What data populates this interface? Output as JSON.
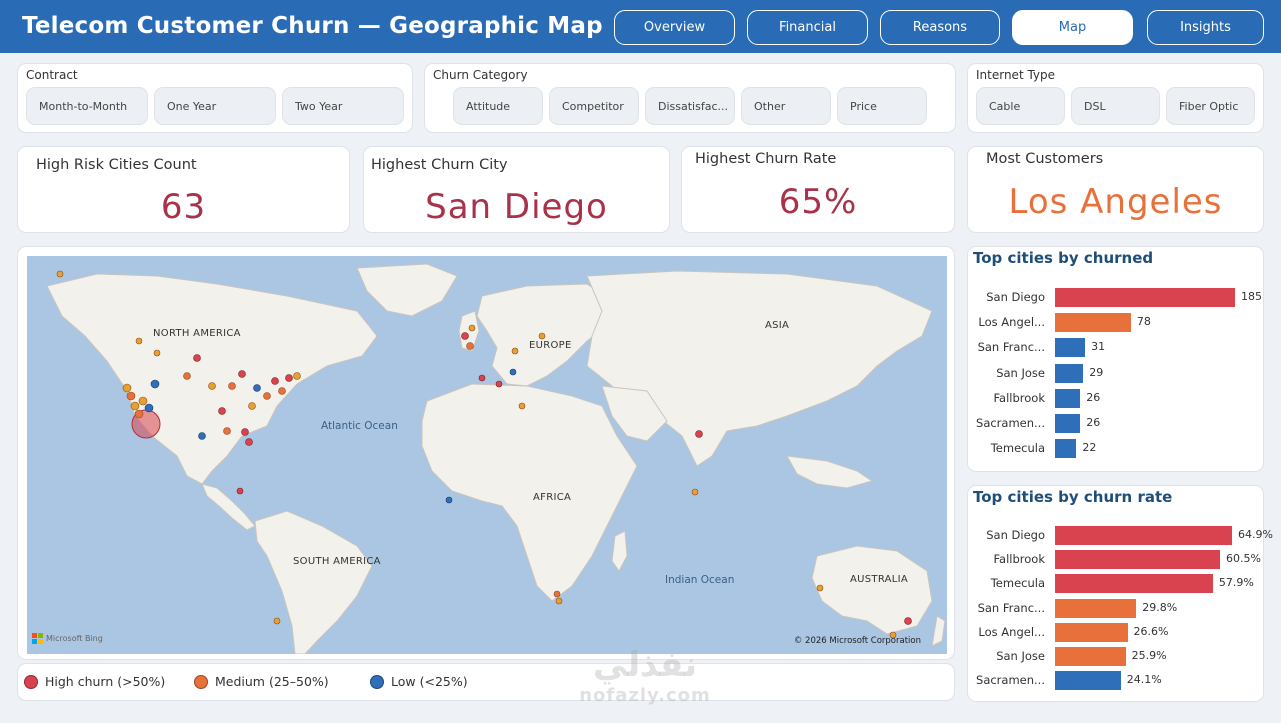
{
  "header": {
    "title": "Telecom Customer Churn — Geographic Map",
    "nav": [
      "Overview",
      "Financial",
      "Reasons",
      "Map",
      "Insights"
    ],
    "active_nav": "Map"
  },
  "slicers": {
    "contract": {
      "title": "Contract",
      "options": [
        "Month-to-Month",
        "One Year",
        "Two Year"
      ]
    },
    "churn_category": {
      "title": "Churn Category",
      "options": [
        "Attitude",
        "Competitor",
        "Dissatisfac...",
        "Other",
        "Price"
      ]
    },
    "internet_type": {
      "title": "Internet Type",
      "options": [
        "Cable",
        "DSL",
        "Fiber Optic"
      ]
    }
  },
  "kpis": {
    "high_risk": {
      "label": "High Risk Cities Count",
      "value": "63"
    },
    "highest_city": {
      "label": "Highest Churn City",
      "value": "San Diego"
    },
    "highest_rate": {
      "label": "Highest Churn Rate",
      "value": "65%"
    },
    "most_customers": {
      "label": "Most Customers",
      "value": "Los Angeles"
    }
  },
  "map": {
    "labels": {
      "north_america": "NORTH AMERICA",
      "south_america": "SOUTH AMERICA",
      "europe": "EUROPE",
      "asia": "ASIA",
      "africa": "AFRICA",
      "australia": "AUSTRALIA",
      "atlantic": "Atlantic Ocean",
      "indian": "Indian Ocean"
    },
    "bing": "Microsoft Bing",
    "copyright": "© 2026 Microsoft Corporation"
  },
  "legend": {
    "high": "High churn (>50%)",
    "medium": "Medium (25–50%)",
    "low": "Low (<25%)"
  },
  "colors": {
    "header": "#2a6bb5",
    "high": "#d9434f",
    "medium": "#e8703a",
    "low": "#2f6fba",
    "kpi_value": "#a8324a",
    "kpi_orange": "#e8703a"
  },
  "top_churned": {
    "title": "Top cities by churned",
    "rows": [
      {
        "city": "San Diego",
        "value": 185,
        "label": "185",
        "level": "high"
      },
      {
        "city": "Los Angel...",
        "value": 78,
        "label": "78",
        "level": "medium"
      },
      {
        "city": "San Franc...",
        "value": 31,
        "label": "31",
        "level": "low"
      },
      {
        "city": "San Jose",
        "value": 29,
        "label": "29",
        "level": "low"
      },
      {
        "city": "Fallbrook",
        "value": 26,
        "label": "26",
        "level": "low"
      },
      {
        "city": "Sacramen...",
        "value": 26,
        "label": "26",
        "level": "low"
      },
      {
        "city": "Temecula",
        "value": 22,
        "label": "22",
        "level": "low"
      }
    ]
  },
  "top_rate": {
    "title": "Top cities by churn rate",
    "rows": [
      {
        "city": "San Diego",
        "value": 64.9,
        "label": "64.9%",
        "level": "high"
      },
      {
        "city": "Fallbrook",
        "value": 60.5,
        "label": "60.5%",
        "level": "high"
      },
      {
        "city": "Temecula",
        "value": 57.9,
        "label": "57.9%",
        "level": "high"
      },
      {
        "city": "San Franc...",
        "value": 29.8,
        "label": "29.8%",
        "level": "medium"
      },
      {
        "city": "Los Angel...",
        "value": 26.6,
        "label": "26.6%",
        "level": "medium"
      },
      {
        "city": "San Jose",
        "value": 25.9,
        "label": "25.9%",
        "level": "medium"
      },
      {
        "city": "Sacramen...",
        "value": 24.1,
        "label": "24.1%",
        "level": "low"
      }
    ]
  },
  "watermark": {
    "arabic": "نفذلي",
    "latin": "nofazly.com"
  }
}
